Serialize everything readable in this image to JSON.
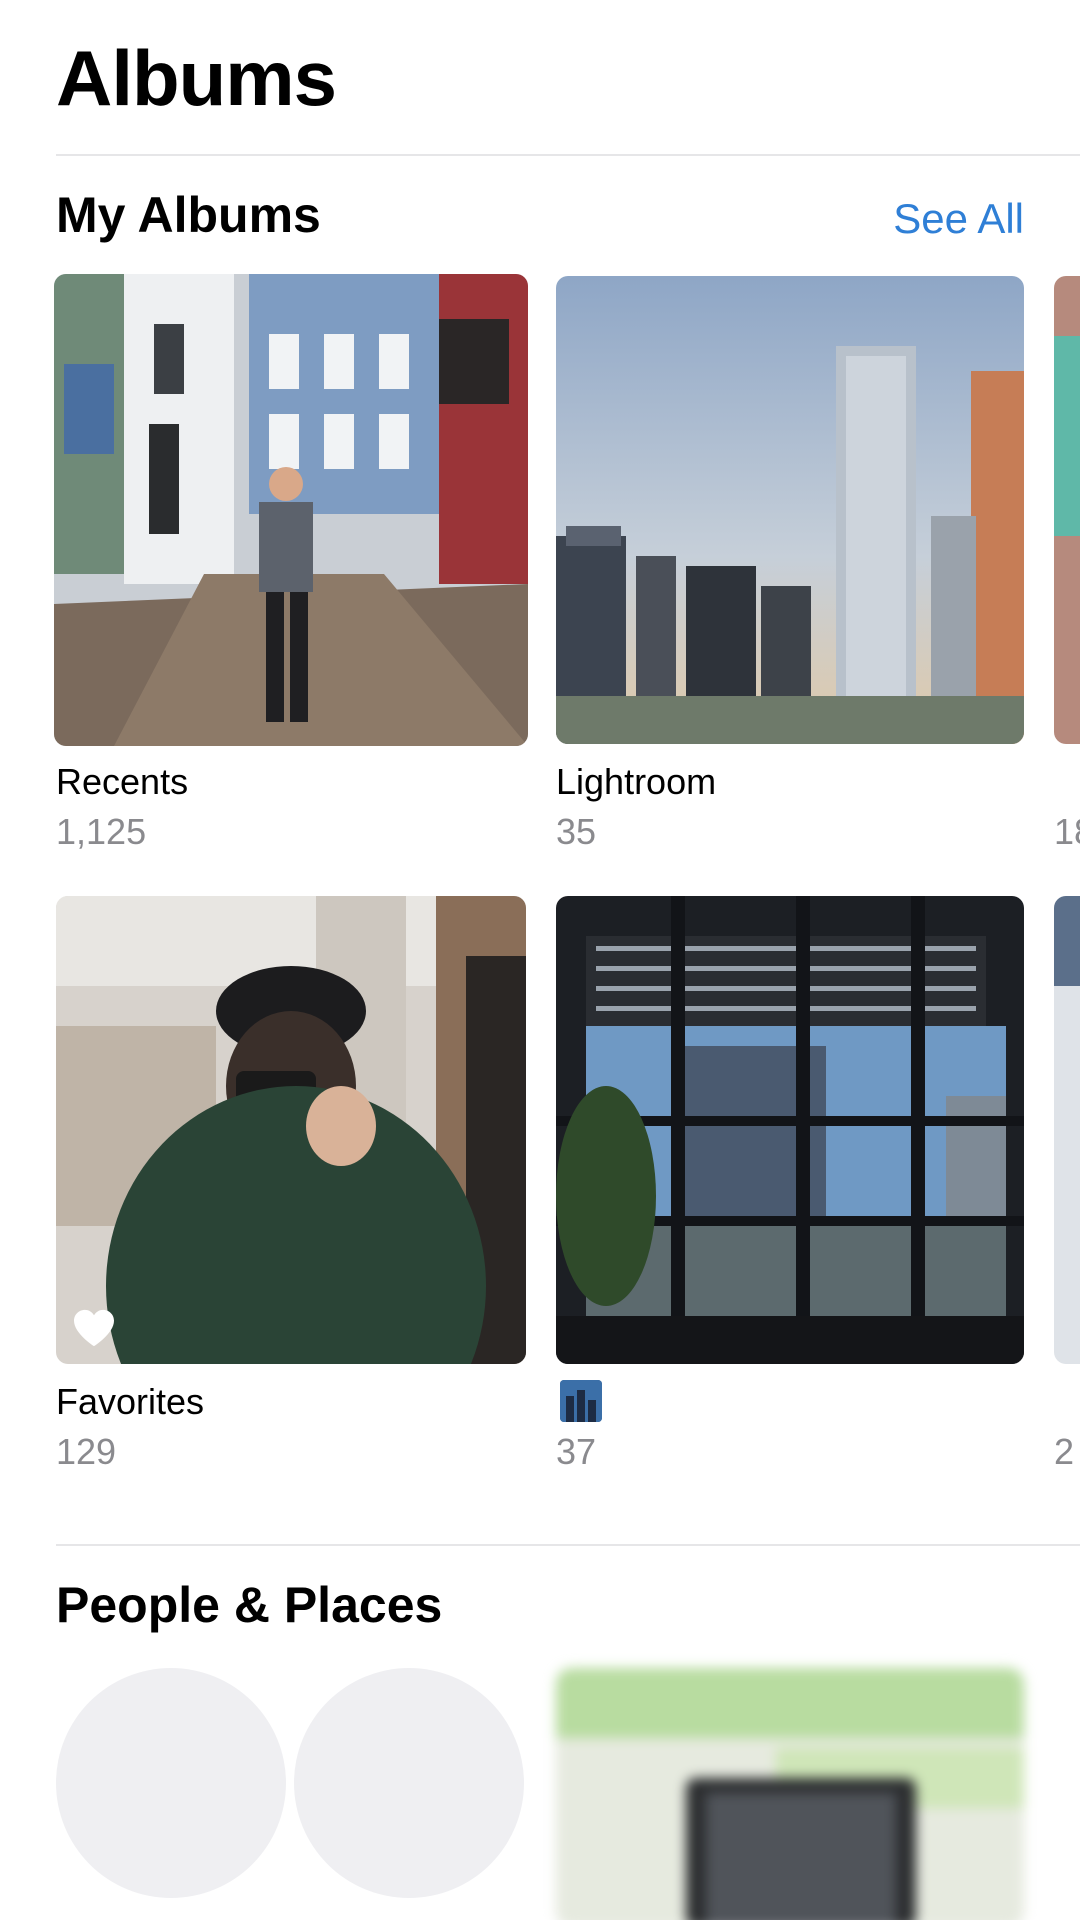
{
  "header": {
    "title": "Albums"
  },
  "my_albums": {
    "title": "My Albums",
    "see_all_label": "See All",
    "albums": [
      {
        "name": "Recents",
        "count": "1,125"
      },
      {
        "name": "Lightroom",
        "count": "35"
      },
      {
        "name": "Favorites",
        "count": "129"
      },
      {
        "name": "",
        "count": "37"
      }
    ],
    "partial_counts": [
      "18",
      "2"
    ]
  },
  "people_places": {
    "title": "People & Places"
  },
  "colors": {
    "accent": "#2f7fd6",
    "secondary_text": "#8a8a8e",
    "divider": "#e6e6e8"
  }
}
